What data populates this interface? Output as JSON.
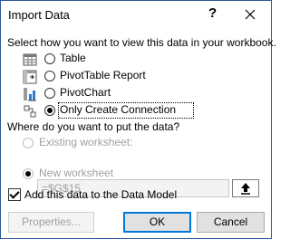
{
  "window": {
    "title": "Import Data",
    "help_label": "?",
    "close_label": "✕"
  },
  "view_prompt": "Select how you want to view this data in your workbook.",
  "view_options": [
    {
      "label": "Table",
      "selected": false,
      "icon": "table-icon"
    },
    {
      "label": "PivotTable Report",
      "selected": false,
      "icon": "pivottable-icon"
    },
    {
      "label": "PivotChart",
      "selected": false,
      "icon": "pivotchart-icon"
    },
    {
      "label": "Only Create Connection",
      "selected": true,
      "icon": "connection-icon"
    }
  ],
  "location_prompt": "Where do you want to put the data?",
  "location_options": [
    {
      "label": "Existing worksheet:",
      "selected": false,
      "enabled": false
    },
    {
      "label": "New worksheet",
      "selected": true,
      "enabled": false
    }
  ],
  "range_field": {
    "value": "=$G$15",
    "button_icon": "collapse-dialog-icon"
  },
  "data_model_checkbox": {
    "label": "Add this data to the Data Model",
    "checked": true
  },
  "buttons": {
    "properties": "Properties...",
    "ok": "OK",
    "cancel": "Cancel"
  }
}
